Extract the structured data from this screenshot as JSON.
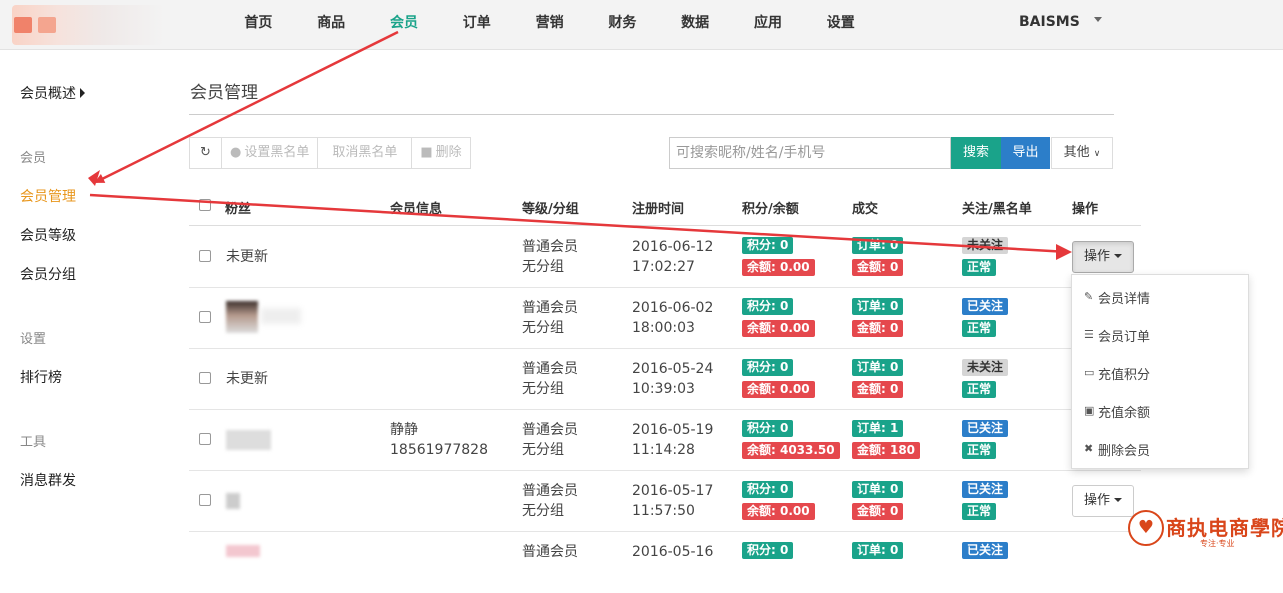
{
  "topnav": {
    "items": [
      "首页",
      "商品",
      "会员",
      "订单",
      "营销",
      "财务",
      "数据",
      "应用",
      "设置"
    ],
    "active_index": 2,
    "user": "BAISMS"
  },
  "sidebar": {
    "overview": "会员概述",
    "group_member": "会员",
    "member_manage": "会员管理",
    "member_level": "会员等级",
    "member_group": "会员分组",
    "group_settings": "设置",
    "ranking": "排行榜",
    "group_tools": "工具",
    "broadcast": "消息群发"
  },
  "main": {
    "title": "会员管理",
    "toolbar": {
      "set_blacklist": "设置黑名单",
      "cancel_blacklist": "取消黑名单",
      "delete": "删除"
    },
    "search": {
      "placeholder": "可搜索昵称/姓名/手机号",
      "search_btn": "搜索",
      "export_btn": "导出",
      "other_btn": "其他"
    },
    "table": {
      "headers": [
        "粉丝",
        "会员信息",
        "等级/分组",
        "注册时间",
        "积分/余额",
        "成交",
        "关注/黑名单",
        "操作"
      ],
      "rows": [
        {
          "fan": "未更新",
          "info_name": "",
          "info_phone": "",
          "level": "普通会员",
          "group": "无分组",
          "date": "2016-06-12",
          "time": "17:02:27",
          "points": "积分: 0",
          "balance": "余额: 0.00",
          "orders": "订单: 0",
          "amount": "金额: 0",
          "follow": "未关注",
          "status": "正常",
          "op": "操作"
        },
        {
          "fan": "",
          "info_name": "",
          "info_phone": "",
          "level": "普通会员",
          "group": "无分组",
          "date": "2016-06-02",
          "time": "18:00:03",
          "points": "积分: 0",
          "balance": "余额: 0.00",
          "orders": "订单: 0",
          "amount": "金额: 0",
          "follow": "已关注",
          "status": "正常",
          "op": ""
        },
        {
          "fan": "未更新",
          "info_name": "",
          "info_phone": "",
          "level": "普通会员",
          "group": "无分组",
          "date": "2016-05-24",
          "time": "10:39:03",
          "points": "积分: 0",
          "balance": "余额: 0.00",
          "orders": "订单: 0",
          "amount": "金额: 0",
          "follow": "未关注",
          "status": "正常",
          "op": ""
        },
        {
          "fan": "",
          "info_name": "静静",
          "info_phone": "18561977828",
          "level": "普通会员",
          "group": "无分组",
          "date": "2016-05-19",
          "time": "11:14:28",
          "points": "积分: 0",
          "balance": "余额: 4033.50",
          "orders": "订单: 1",
          "amount": "金额: 180",
          "follow": "已关注",
          "status": "正常",
          "op": ""
        },
        {
          "fan": "",
          "info_name": "",
          "info_phone": "",
          "level": "普通会员",
          "group": "无分组",
          "date": "2016-05-17",
          "time": "11:57:50",
          "points": "积分: 0",
          "balance": "余额: 0.00",
          "orders": "订单: 0",
          "amount": "金额: 0",
          "follow": "已关注",
          "status": "正常",
          "op": "操作"
        },
        {
          "fan": "",
          "info_name": "",
          "info_phone": "",
          "level": "普通会员",
          "group": "",
          "date": "2016-05-16",
          "time": "",
          "points": "积分: 0",
          "balance": "",
          "orders": "订单: 0",
          "amount": "",
          "follow": "已关注",
          "status": "",
          "op": ""
        }
      ]
    },
    "dropdown": [
      "会员详情",
      "会员订单",
      "充值积分",
      "充值余额",
      "删除会员"
    ]
  },
  "watermark": {
    "text": "商执电商學院",
    "sub": "专注·专业"
  },
  "colors": {
    "green": "#1aa38a",
    "blue": "#2c7ec9",
    "red": "#e5484d",
    "orange": "#e8961c",
    "arrow": "#e5383b"
  }
}
